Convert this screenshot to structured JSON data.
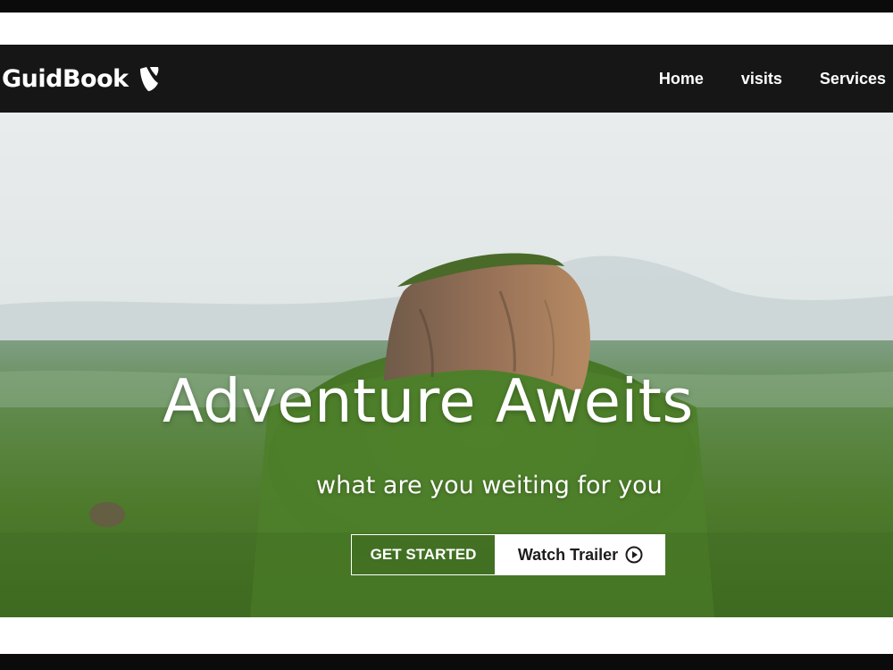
{
  "nav": {
    "brand": "GuidBook",
    "brand_icon": "typo3-logo-icon",
    "items": [
      {
        "label": "Home"
      },
      {
        "label": "visits"
      },
      {
        "label": "Services"
      }
    ]
  },
  "hero": {
    "headline": "Adventure Aweits",
    "subheadline": "what are you weiting for you",
    "primary_button": "GET STARTED",
    "secondary_button": "Watch Trailer",
    "secondary_icon": "play-circle-icon"
  },
  "colors": {
    "navbar": "#161616",
    "text": "#ffffff",
    "button_bg": "#ffffff",
    "button_text": "#1c1c1c"
  }
}
